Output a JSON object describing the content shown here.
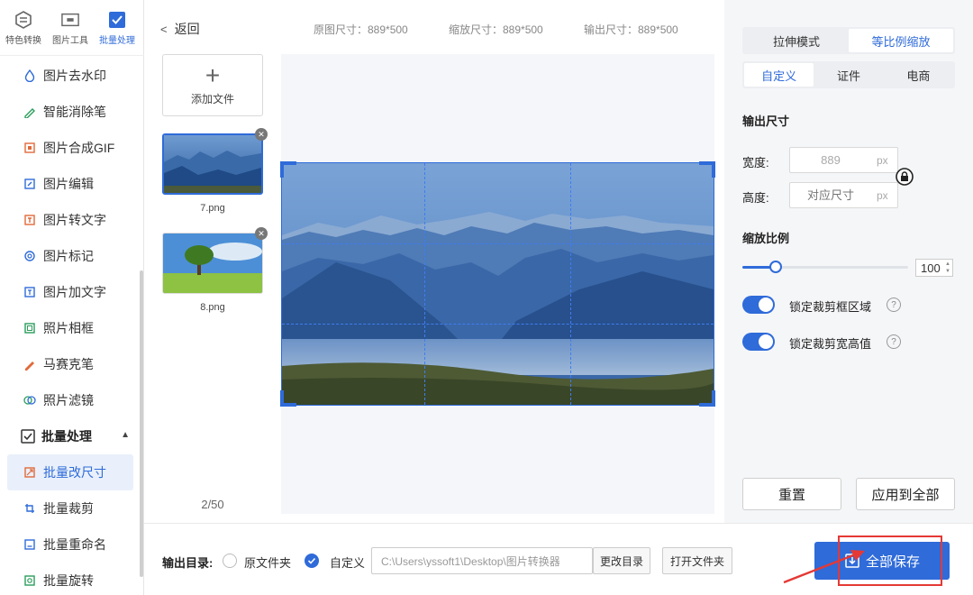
{
  "top_tabs": [
    {
      "label": "特色转换",
      "icon": "convert-icon"
    },
    {
      "label": "图片工具",
      "icon": "image-tool-icon"
    },
    {
      "label": "批量处理",
      "icon": "batch-icon",
      "active": true
    }
  ],
  "nav": {
    "items": [
      {
        "label": "图片去水印",
        "icon": "drop-icon"
      },
      {
        "label": "智能消除笔",
        "icon": "brush-icon"
      },
      {
        "label": "图片合成GIF",
        "icon": "gif-icon"
      },
      {
        "label": "图片编辑",
        "icon": "edit-icon"
      },
      {
        "label": "图片转文字",
        "icon": "text-icon"
      },
      {
        "label": "图片标记",
        "icon": "mark-icon"
      },
      {
        "label": "图片加文字",
        "icon": "add-text-icon"
      },
      {
        "label": "照片相框",
        "icon": "frame-icon"
      },
      {
        "label": "马赛克笔",
        "icon": "mosaic-pen-icon"
      },
      {
        "label": "照片滤镜",
        "icon": "filter-icon"
      }
    ],
    "group": {
      "label": "批量处理",
      "icon": "batch-check-icon"
    },
    "sub_items": [
      {
        "label": "批量改尺寸",
        "icon": "resize-icon",
        "active": true
      },
      {
        "label": "批量裁剪",
        "icon": "crop-icon"
      },
      {
        "label": "批量重命名",
        "icon": "rename-icon"
      },
      {
        "label": "批量旋转",
        "icon": "rotate-icon"
      }
    ]
  },
  "header": {
    "back": "返回",
    "original_size": "原图尺寸：889*500",
    "scaled_size": "缩放尺寸：889*500",
    "output_size": "输出尺寸：889*500"
  },
  "files": {
    "add_label": "添加文件",
    "items": [
      {
        "name": "7.png"
      },
      {
        "name": "8.png"
      }
    ],
    "pager": "2/50"
  },
  "panel": {
    "mode_tabs": [
      "拉伸模式",
      "等比例缩放"
    ],
    "preset_tabs": [
      "自定义",
      "证件",
      "电商"
    ],
    "output_title": "输出尺寸",
    "width_label": "宽度:",
    "width_value": "889",
    "height_label": "高度:",
    "height_placeholder": "对应尺寸",
    "unit": "px",
    "scale_title": "缩放比例",
    "scale_value": "100",
    "lock_crop_label": "锁定裁剪框区域",
    "lock_ratio_label": "锁定裁剪宽高值",
    "reset_label": "重置",
    "apply_all_label": "应用到全部"
  },
  "bottom": {
    "dir_label": "输出目录:",
    "original_folder": "原文件夹",
    "custom": "自定义",
    "path": "C:\\Users\\yssoft1\\Desktop\\图片转换器",
    "change_dir": "更改目录",
    "open_folder": "打开文件夹",
    "save_all": "全部保存"
  },
  "colors": {
    "accent": "#2f6bd9",
    "highlight": "#e53935"
  }
}
